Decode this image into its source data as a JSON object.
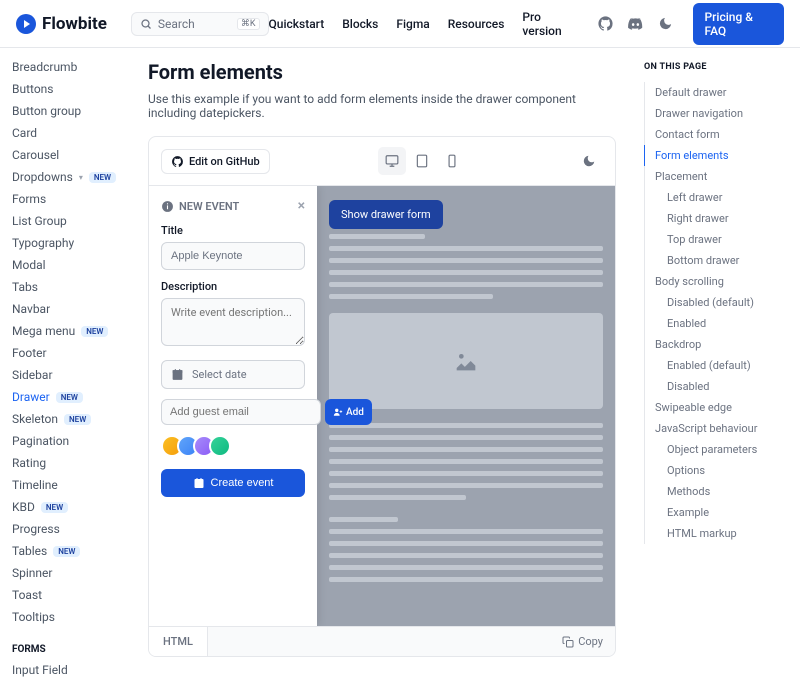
{
  "brand": "Flowbite",
  "search": {
    "placeholder": "Search",
    "kbd": "⌘K"
  },
  "nav": {
    "quickstart": "Quickstart",
    "blocks": "Blocks",
    "figma": "Figma",
    "resources": "Resources",
    "pro": "Pro version",
    "cta": "Pricing & FAQ"
  },
  "sidebar": {
    "items": [
      {
        "label": "Breadcrumb"
      },
      {
        "label": "Buttons"
      },
      {
        "label": "Button group"
      },
      {
        "label": "Card"
      },
      {
        "label": "Carousel"
      },
      {
        "label": "Dropdowns",
        "new": true,
        "badge": "NEW"
      },
      {
        "label": "Forms"
      },
      {
        "label": "List Group"
      },
      {
        "label": "Typography"
      },
      {
        "label": "Modal"
      },
      {
        "label": "Tabs"
      },
      {
        "label": "Navbar"
      },
      {
        "label": "Mega menu",
        "new": true,
        "badge": "NEW"
      },
      {
        "label": "Footer"
      },
      {
        "label": "Sidebar"
      },
      {
        "label": "Drawer",
        "new": true,
        "badge": "NEW",
        "active": true
      },
      {
        "label": "Skeleton",
        "new": true,
        "badge": "NEW"
      },
      {
        "label": "Pagination"
      },
      {
        "label": "Rating"
      },
      {
        "label": "Timeline"
      },
      {
        "label": "KBD",
        "new": true,
        "badge": "NEW"
      },
      {
        "label": "Progress"
      },
      {
        "label": "Tables",
        "new": true,
        "badge": "NEW"
      },
      {
        "label": "Spinner"
      },
      {
        "label": "Toast"
      },
      {
        "label": "Tooltips"
      }
    ],
    "forms_heading": "FORMS",
    "forms_items": [
      {
        "label": "Input Field"
      }
    ]
  },
  "page": {
    "title": "Form elements",
    "description": "Use this example if you want to add form elements inside the drawer component including datepickers.",
    "edit_github": "Edit on GitHub",
    "show_drawer": "Show drawer form",
    "code_tab": "HTML",
    "copy": "Copy"
  },
  "drawer": {
    "heading": "NEW EVENT",
    "title_label": "Title",
    "title_value": "Apple Keynote",
    "desc_label": "Description",
    "desc_placeholder": "Write event description...",
    "date_placeholder": "Select date",
    "guest_placeholder": "Add guest email",
    "add_btn": "Add",
    "create_btn": "Create event"
  },
  "toc": {
    "title": "ON THIS PAGE",
    "items": [
      {
        "label": "Default drawer"
      },
      {
        "label": "Drawer navigation"
      },
      {
        "label": "Contact form"
      },
      {
        "label": "Form elements",
        "active": true
      },
      {
        "label": "Placement"
      },
      {
        "label": "Left drawer",
        "sub": true
      },
      {
        "label": "Right drawer",
        "sub": true
      },
      {
        "label": "Top drawer",
        "sub": true
      },
      {
        "label": "Bottom drawer",
        "sub": true
      },
      {
        "label": "Body scrolling"
      },
      {
        "label": "Disabled (default)",
        "sub": true
      },
      {
        "label": "Enabled",
        "sub": true
      },
      {
        "label": "Backdrop"
      },
      {
        "label": "Enabled (default)",
        "sub": true
      },
      {
        "label": "Disabled",
        "sub": true
      },
      {
        "label": "Swipeable edge"
      },
      {
        "label": "JavaScript behaviour"
      },
      {
        "label": "Object parameters",
        "sub": true
      },
      {
        "label": "Options",
        "sub": true
      },
      {
        "label": "Methods",
        "sub": true
      },
      {
        "label": "Example",
        "sub": true
      },
      {
        "label": "HTML markup",
        "sub": true
      }
    ]
  }
}
